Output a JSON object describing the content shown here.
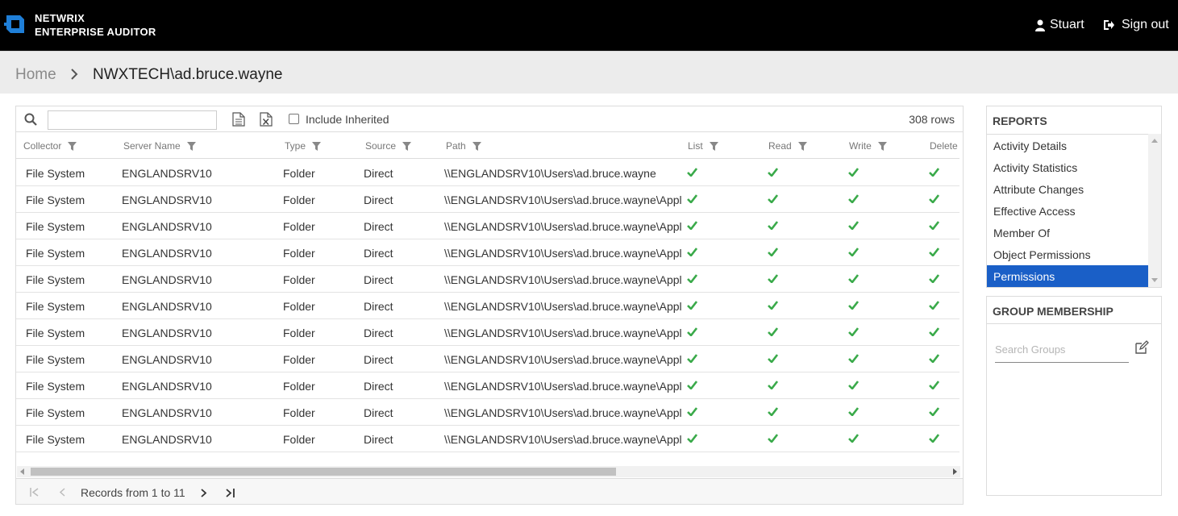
{
  "app": {
    "brand_line1": "NETWRIX",
    "brand_line2": "ENTERPRISE AUDITOR",
    "user_name": "Stuart",
    "signout_label": "Sign out",
    "accent_color": "#1a5fc7",
    "logo_color": "#1f7fd8"
  },
  "breadcrumb": {
    "home": "Home",
    "current": "NWXTECH\\ad.bruce.wayne"
  },
  "toolbar": {
    "search_value": "",
    "include_inherited_label": "Include Inherited",
    "include_inherited_checked": false,
    "row_count": "308 rows"
  },
  "columns": [
    "Collector",
    "Server Name",
    "Type",
    "Source",
    "Path",
    "List",
    "Read",
    "Write",
    "Delete"
  ],
  "rows": [
    {
      "collector": "File System",
      "server": "ENGLANDSRV10",
      "type": "Folder",
      "source": "Direct",
      "path": "\\\\ENGLANDSRV10\\Users\\ad.bruce.wayne",
      "list": true,
      "read": true,
      "write": true,
      "delete": true
    },
    {
      "collector": "File System",
      "server": "ENGLANDSRV10",
      "type": "Folder",
      "source": "Direct",
      "path": "\\\\ENGLANDSRV10\\Users\\ad.bruce.wayne\\Appl",
      "list": true,
      "read": true,
      "write": true,
      "delete": true
    },
    {
      "collector": "File System",
      "server": "ENGLANDSRV10",
      "type": "Folder",
      "source": "Direct",
      "path": "\\\\ENGLANDSRV10\\Users\\ad.bruce.wayne\\Appl",
      "list": true,
      "read": true,
      "write": true,
      "delete": true
    },
    {
      "collector": "File System",
      "server": "ENGLANDSRV10",
      "type": "Folder",
      "source": "Direct",
      "path": "\\\\ENGLANDSRV10\\Users\\ad.bruce.wayne\\Appl",
      "list": true,
      "read": true,
      "write": true,
      "delete": true
    },
    {
      "collector": "File System",
      "server": "ENGLANDSRV10",
      "type": "Folder",
      "source": "Direct",
      "path": "\\\\ENGLANDSRV10\\Users\\ad.bruce.wayne\\Appl",
      "list": true,
      "read": true,
      "write": true,
      "delete": true
    },
    {
      "collector": "File System",
      "server": "ENGLANDSRV10",
      "type": "Folder",
      "source": "Direct",
      "path": "\\\\ENGLANDSRV10\\Users\\ad.bruce.wayne\\Appl",
      "list": true,
      "read": true,
      "write": true,
      "delete": true
    },
    {
      "collector": "File System",
      "server": "ENGLANDSRV10",
      "type": "Folder",
      "source": "Direct",
      "path": "\\\\ENGLANDSRV10\\Users\\ad.bruce.wayne\\Appl",
      "list": true,
      "read": true,
      "write": true,
      "delete": true
    },
    {
      "collector": "File System",
      "server": "ENGLANDSRV10",
      "type": "Folder",
      "source": "Direct",
      "path": "\\\\ENGLANDSRV10\\Users\\ad.bruce.wayne\\Appl",
      "list": true,
      "read": true,
      "write": true,
      "delete": true
    },
    {
      "collector": "File System",
      "server": "ENGLANDSRV10",
      "type": "Folder",
      "source": "Direct",
      "path": "\\\\ENGLANDSRV10\\Users\\ad.bruce.wayne\\Appl",
      "list": true,
      "read": true,
      "write": true,
      "delete": true
    },
    {
      "collector": "File System",
      "server": "ENGLANDSRV10",
      "type": "Folder",
      "source": "Direct",
      "path": "\\\\ENGLANDSRV10\\Users\\ad.bruce.wayne\\Appl",
      "list": true,
      "read": true,
      "write": true,
      "delete": true
    },
    {
      "collector": "File System",
      "server": "ENGLANDSRV10",
      "type": "Folder",
      "source": "Direct",
      "path": "\\\\ENGLANDSRV10\\Users\\ad.bruce.wayne\\Appl",
      "list": true,
      "read": true,
      "write": true,
      "delete": true
    }
  ],
  "check_color": "#3aaa4a",
  "pager": {
    "records_label": "Records from 1 to 11"
  },
  "reports": {
    "title": "REPORTS",
    "items": [
      "Activity Details",
      "Activity Statistics",
      "Attribute Changes",
      "Effective Access",
      "Member Of",
      "Object Permissions",
      "Permissions"
    ],
    "active": "Permissions"
  },
  "groups": {
    "title": "GROUP MEMBERSHIP",
    "search_placeholder": "Search Groups",
    "search_value": ""
  }
}
